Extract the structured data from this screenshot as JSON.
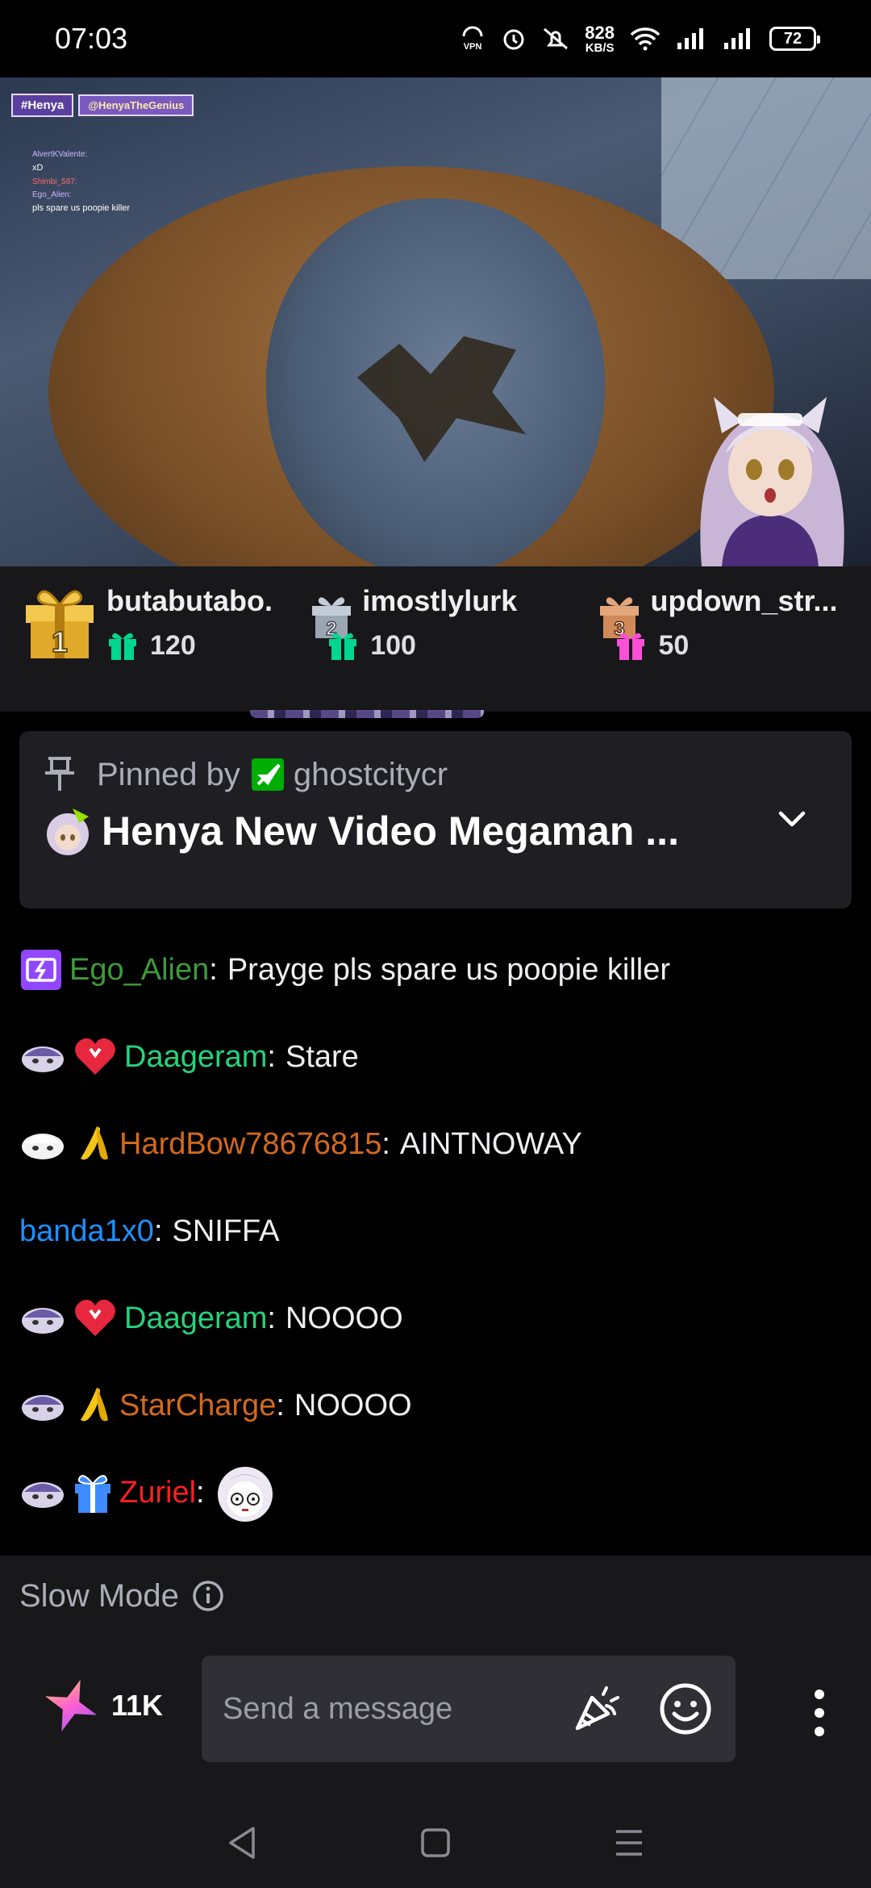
{
  "status_bar": {
    "time": "07:03",
    "vpn_label": "VPN",
    "net_speed": "828",
    "net_unit": "KB/S",
    "battery": "72"
  },
  "video": {
    "overlay_tag": "#Henya",
    "overlay_handle": "@HenyaTheGenius",
    "overlay_chat": [
      {
        "user": "AlvertKValente:",
        "msg": "xD"
      },
      {
        "user": "Shimbi_587:",
        "msg": ""
      },
      {
        "user": "Ego_Alien:",
        "msg": "pls spare us poopie killer"
      }
    ]
  },
  "leaderboard": [
    {
      "rank": "1",
      "name": "butabutabo.",
      "count": "120",
      "color": "#f2c94c",
      "gift_color": "#00d68f"
    },
    {
      "rank": "2",
      "name": "imostlylurk",
      "count": "100",
      "color": "#9aa6b2",
      "gift_color": "#00d68f"
    },
    {
      "rank": "3",
      "name": "updown_str...",
      "count": "50",
      "color": "#d08a5a",
      "gift_color": "#ff4fd8"
    }
  ],
  "pinned": {
    "label": "Pinned by",
    "user": "ghostcitycr",
    "title": "Henya New Video Megaman ..."
  },
  "chat": [
    {
      "user": "Ego_Alien",
      "color": "#3f9a3a",
      "text": "Prayge pls spare us poopie killer"
    },
    {
      "user": "Daageram",
      "color": "#25d37b",
      "text": "Stare"
    },
    {
      "user": "HardBow78676815",
      "color": "#d2691e",
      "text": "AINTNOWAY"
    },
    {
      "user": "banda1x0",
      "color": "#1e90ff",
      "text": "SNIFFA"
    },
    {
      "user": "Daageram",
      "color": "#25d37b",
      "text": "NOOOO"
    },
    {
      "user": "StarCharge",
      "color": "#d2691e",
      "text": "NOOOO"
    },
    {
      "user": "Zuriel",
      "color": "#ff2020",
      "text": ""
    }
  ],
  "slow_mode": "Slow Mode",
  "input": {
    "points": "11K",
    "placeholder": "Send a message"
  },
  "colors": {
    "accent": "#9147ff",
    "panel": "#18181b",
    "pinned_bg": "#1f1f23"
  },
  "icons": {
    "cheer": "cheer-icon",
    "emoji": "emoji-icon",
    "more": "kebab-icon"
  }
}
